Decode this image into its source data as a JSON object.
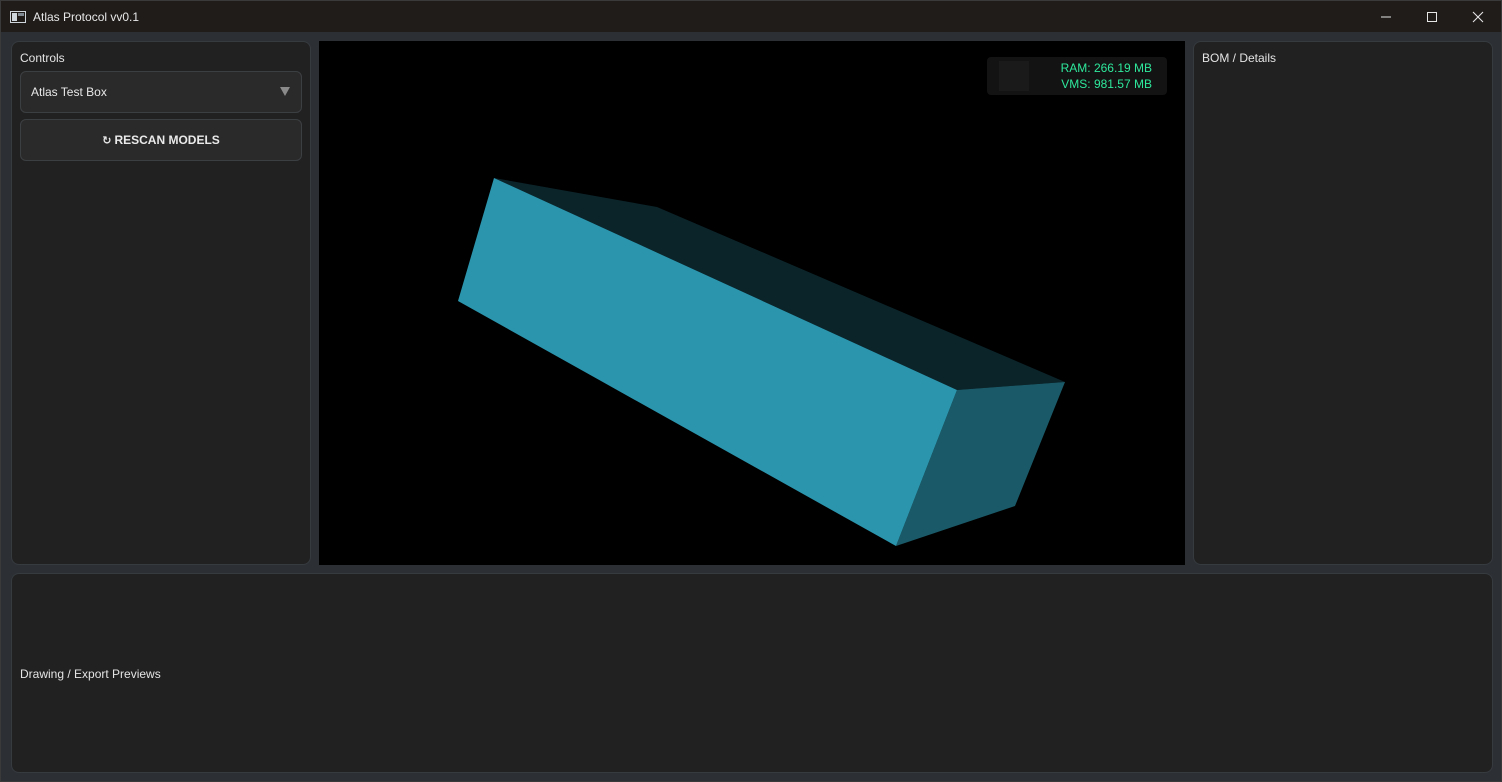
{
  "window": {
    "title": "Atlas Protocol vv0.1"
  },
  "controls": {
    "label": "Controls",
    "model_select": {
      "selected": "Atlas Test Box"
    },
    "rescan_button": {
      "icon": "refresh-icon",
      "label": "RESCAN MODELS"
    }
  },
  "viewport": {
    "stats": {
      "ram": "RAM: 266.19 MB",
      "vms": "VMS: 981.57 MB"
    },
    "colors": {
      "front_face": "#2b95ad",
      "top_face": "#0b242a",
      "end_face": "#1a5a68",
      "stats_text": "#2ee89c"
    }
  },
  "bom": {
    "label": "BOM / Details"
  },
  "previews": {
    "label": "Drawing / Export Previews"
  }
}
